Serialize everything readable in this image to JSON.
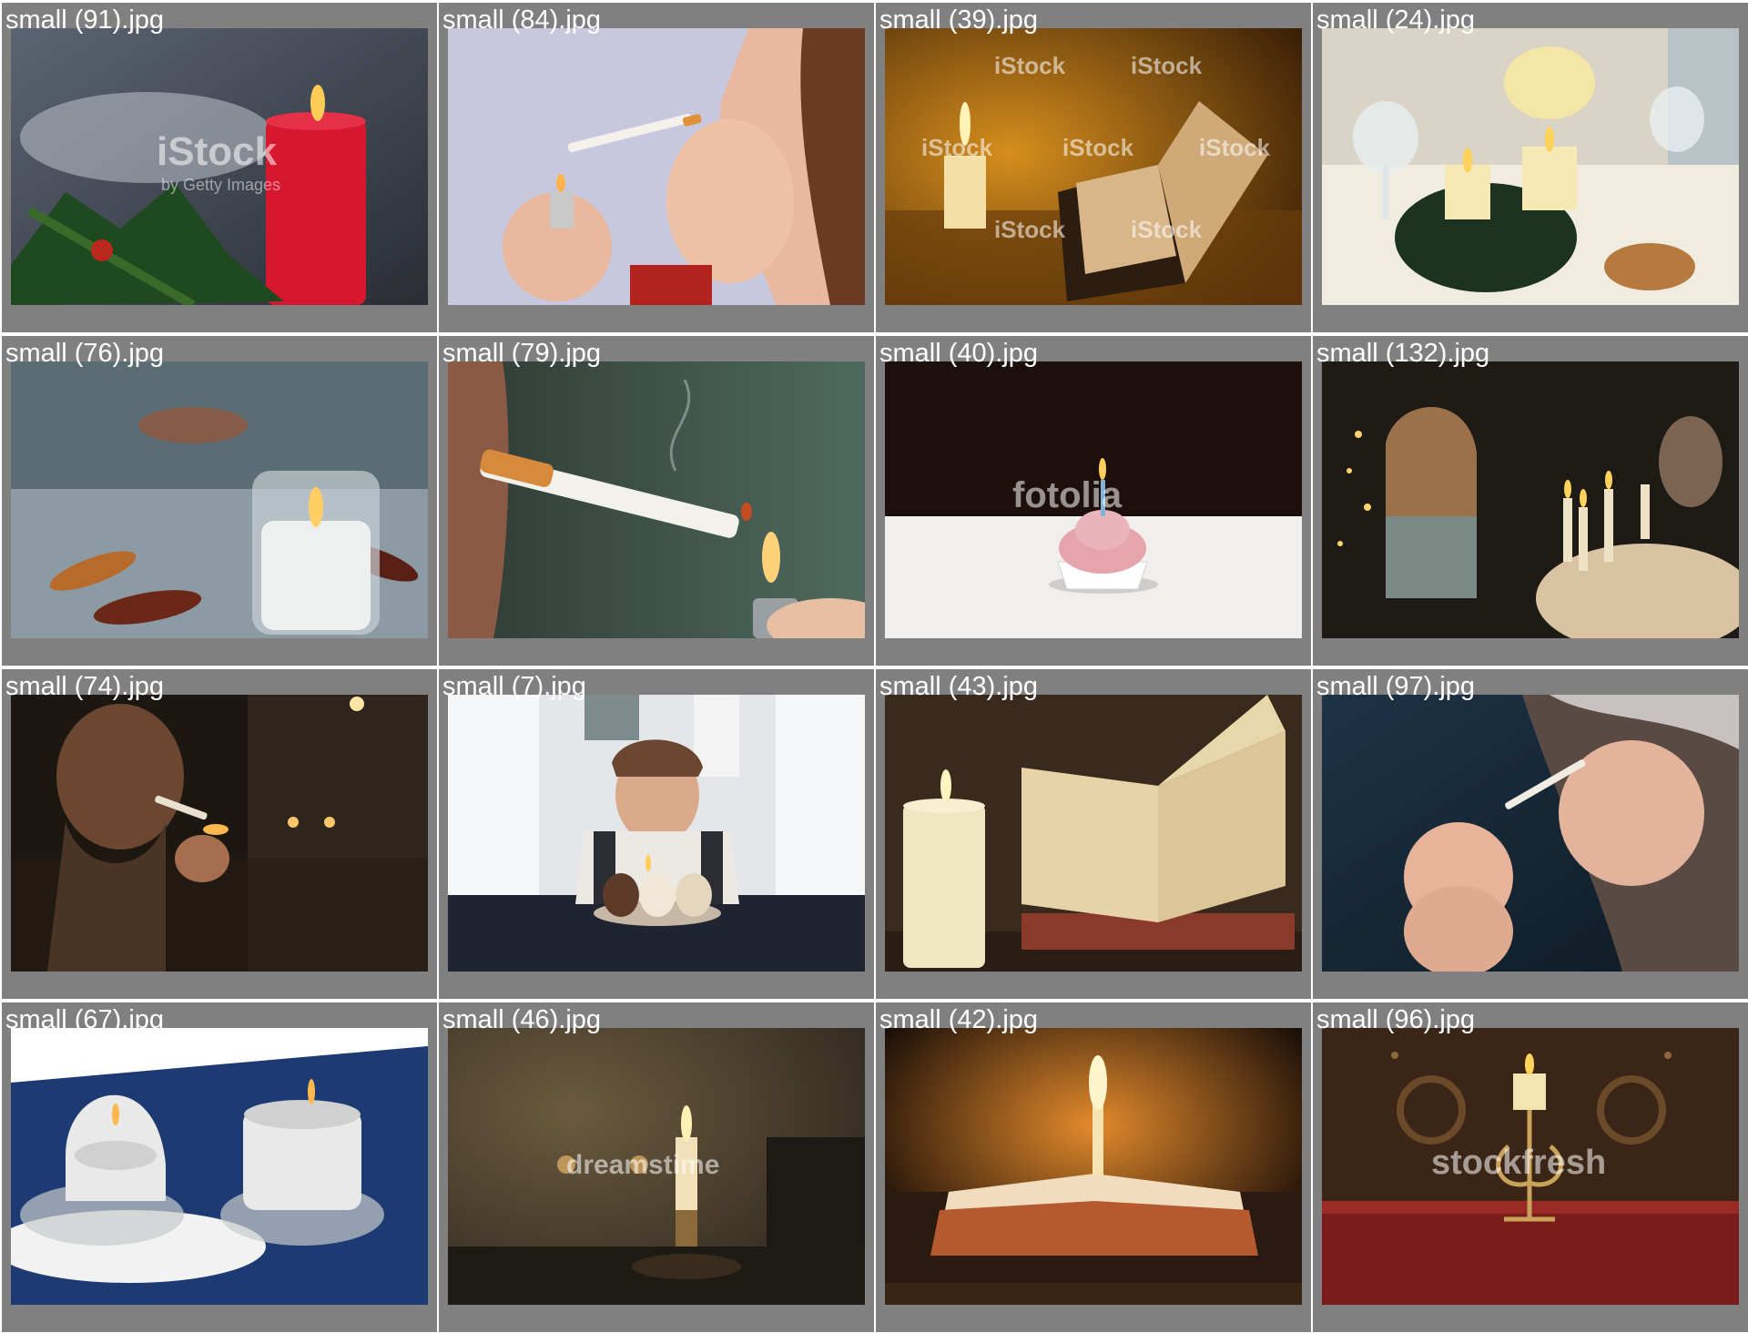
{
  "gallery": {
    "tiles": [
      {
        "filename": "small (91).jpg",
        "subject": "red candle with pine branch"
      },
      {
        "filename": "small (84).jpg",
        "subject": "woman lighting cigarette"
      },
      {
        "filename": "small (39).jpg",
        "subject": "candle and open book"
      },
      {
        "filename": "small (24).jpg",
        "subject": "table setting with candles"
      },
      {
        "filename": "small (76).jpg",
        "subject": "glass candle with petals"
      },
      {
        "filename": "small (79).jpg",
        "subject": "man lighting cigarette"
      },
      {
        "filename": "small (40).jpg",
        "subject": "cupcake with candle"
      },
      {
        "filename": "small (132).jpg",
        "subject": "girl with candles"
      },
      {
        "filename": "small (74).jpg",
        "subject": "man lighting pipe"
      },
      {
        "filename": "small (7).jpg",
        "subject": "boy blowing cupcake candle"
      },
      {
        "filename": "small (43).jpg",
        "subject": "pillar candle and book"
      },
      {
        "filename": "small (97).jpg",
        "subject": "person lighting cigarette"
      },
      {
        "filename": "small (67).jpg",
        "subject": "two melted candles"
      },
      {
        "filename": "small (46).jpg",
        "subject": "candle in holder"
      },
      {
        "filename": "small (42).jpg",
        "subject": "candle and bible"
      },
      {
        "filename": "small (96).jpg",
        "subject": "candle on ornate holder"
      }
    ]
  },
  "watermarks": {
    "istock": "iStock",
    "istock_sub": "by Getty Images",
    "fotolia": "fotolia",
    "stockfresh": "stockfresh",
    "dreamstime": "dreamstime"
  }
}
